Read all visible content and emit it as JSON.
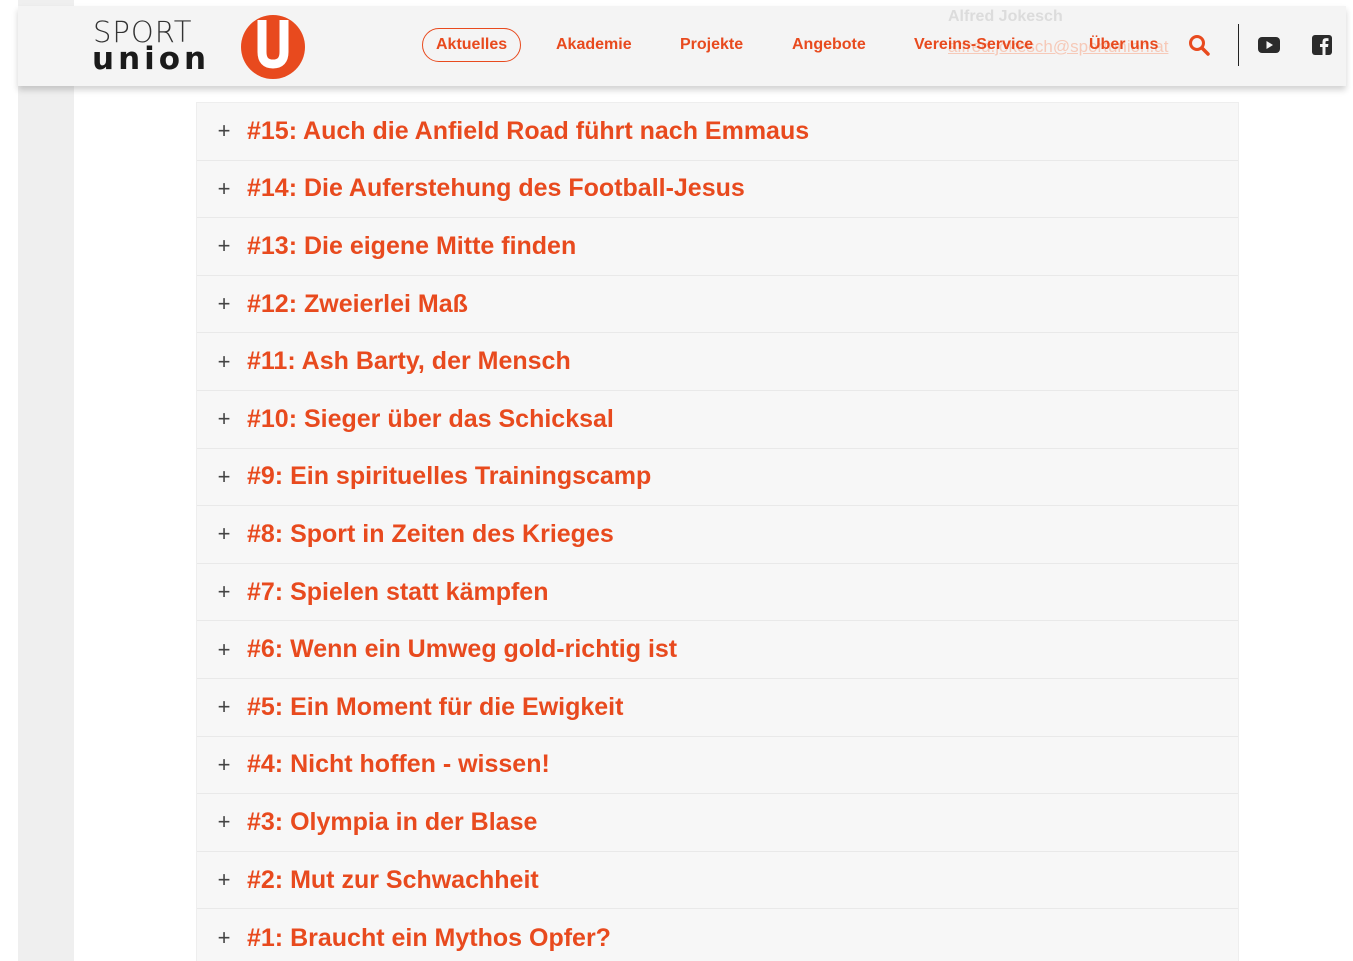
{
  "brand": {
    "line1": "SPORT",
    "line2": "union",
    "accent_color": "#e84a1e"
  },
  "header": {
    "ghost_name": "Alfred Jokesch",
    "ghost_email": "alfred.jokesch@sportunion.at",
    "nav": [
      {
        "label": "Aktuelles",
        "active": true
      },
      {
        "label": "Akademie",
        "active": false
      },
      {
        "label": "Projekte",
        "active": false
      },
      {
        "label": "Angebote",
        "active": false
      },
      {
        "label": "Vereins-Service",
        "active": false
      },
      {
        "label": "Über uns",
        "active": false
      }
    ],
    "icons": [
      "search-icon",
      "youtube-icon",
      "facebook-icon"
    ]
  },
  "accordion": {
    "expand_symbol": "+",
    "items": [
      {
        "title": "#15: Auch die Anfield Road führt nach Emmaus"
      },
      {
        "title": "#14: Die Auferstehung des Football-Jesus"
      },
      {
        "title": "#13: Die eigene Mitte finden"
      },
      {
        "title": "#12: Zweierlei Maß"
      },
      {
        "title": "#11: Ash Barty, der Mensch"
      },
      {
        "title": "#10: Sieger über das Schicksal"
      },
      {
        "title": "#9: Ein spirituelles Trainingscamp"
      },
      {
        "title": "#8: Sport in Zeiten des Krieges"
      },
      {
        "title": "#7: Spielen statt kämpfen"
      },
      {
        "title": "#6: Wenn ein Umweg gold-richtig ist"
      },
      {
        "title": "#5: Ein Moment für die Ewigkeit"
      },
      {
        "title": "#4: Nicht hoffen - wissen!"
      },
      {
        "title": "#3: Olympia in der Blase"
      },
      {
        "title": "#2: Mut zur Schwachheit"
      },
      {
        "title": "#1: Braucht ein Mythos Opfer?"
      }
    ]
  }
}
